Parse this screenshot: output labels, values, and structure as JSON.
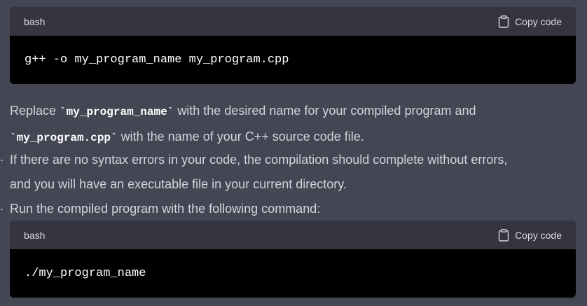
{
  "code_block_1": {
    "language": "bash",
    "copy_label": "Copy code",
    "code": "g++ -o my_program_name my_program.cpp"
  },
  "paragraph_1": {
    "pre": "Replace ",
    "code1": "`my_program_name`",
    "mid": " with the desired name for your compiled program and",
    "code2": "`my_program.cpp`",
    "post": " with the name of your C++ source code file."
  },
  "paragraph_2": {
    "line1": "If there are no syntax errors in your code, the compilation should complete without errors,",
    "line2": "and you will have an executable file in your current directory."
  },
  "paragraph_3": {
    "line1": "Run the compiled program with the following command:"
  },
  "code_block_2": {
    "language": "bash",
    "copy_label": "Copy code",
    "code": "./my_program_name"
  },
  "colors": {
    "background": "#444654",
    "code_header": "#343541",
    "code_body": "#000000",
    "text": "#d1d5db"
  },
  "icons": [
    "clipboard-icon"
  ]
}
